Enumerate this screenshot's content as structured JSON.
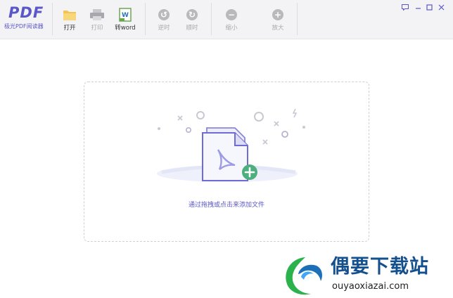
{
  "app": {
    "logo_text": "PDF",
    "logo_subtitle": "极光PDF阅读器",
    "brand_color": "#5b57c9"
  },
  "toolbar": {
    "open_label": "打开",
    "print_label": "打印",
    "to_word_label": "转word",
    "rotate_left_label": "逆时",
    "rotate_right_label": "顺时",
    "zoom_out_label": "缩小",
    "zoom_in_label": "放大"
  },
  "window_controls": {
    "feedback_icon": "feedback-icon",
    "minimize_icon": "minimize-icon",
    "maximize_icon": "maximize-icon",
    "close_icon": "close-icon"
  },
  "dropzone": {
    "hint": "通过拖拽或点击来添加文件",
    "accent_color": "#5b57c9",
    "add_color": "#4caf7d"
  },
  "watermark": {
    "title": "偶要下载站",
    "url": "ouyaoxiazai.com"
  }
}
